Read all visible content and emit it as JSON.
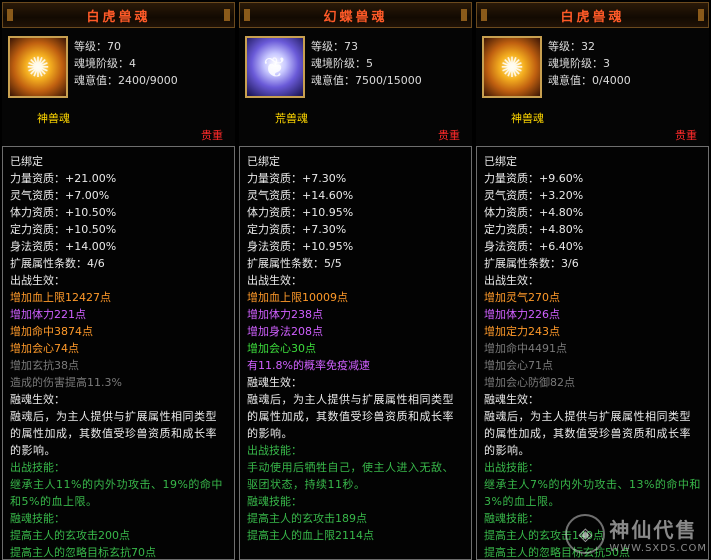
{
  "panels": [
    {
      "title": "白虎兽魂",
      "icon": "tiger-icon",
      "level": "等级：70",
      "stage": "魂境阶级：4",
      "exp": "魂意值：2400/9000",
      "type_label": "神兽魂",
      "rarity": "贵重",
      "bound": "已绑定",
      "attrs": [
        "力量资质：+21.00%",
        "灵气资质：+7.00%",
        "体力资质：+10.50%",
        "定力资质：+10.50%",
        "身法资质：+14.00%"
      ],
      "ext_count": "扩展属性条数：4/6",
      "battle_title": "出战生效：",
      "battle_effects": [
        {
          "text": "增加血上限12427点",
          "color": "orange"
        },
        {
          "text": "增加体力221点",
          "color": "purple"
        },
        {
          "text": "增加命中3874点",
          "color": "orange"
        },
        {
          "text": "增加会心74点",
          "color": "orange"
        },
        {
          "text": "增加玄抗38点",
          "color": "gray"
        },
        {
          "text": "造成的伤害提高11.3%",
          "color": "gray"
        }
      ],
      "fusion_title": "融魂生效：",
      "fusion_desc": "融魂后，为主人提供与扩展属性相同类型的属性加成，其数值受珍兽资质和成长率的影响。",
      "skill_title": "出战技能：",
      "skill_desc": "继承主人11%的内外功攻击、19%的命中和5%的血上限。",
      "fskill_title": "融魂技能：",
      "fskill_lines": [
        "提高主人的玄攻击200点",
        "提高主人的忽略目标玄抗70点"
      ]
    },
    {
      "title": "幻蝶兽魂",
      "icon": "butterfly-icon",
      "level": "等级：73",
      "stage": "魂境阶级：5",
      "exp": "魂意值：7500/15000",
      "type_label": "荒兽魂",
      "rarity": "贵重",
      "bound": "已绑定",
      "attrs": [
        "力量资质：+7.30%",
        "灵气资质：+14.60%",
        "体力资质：+10.95%",
        "定力资质：+7.30%",
        "身法资质：+10.95%"
      ],
      "ext_count": "扩展属性条数：5/5",
      "battle_title": "出战生效：",
      "battle_effects": [
        {
          "text": "增加血上限10009点",
          "color": "orange"
        },
        {
          "text": "增加体力238点",
          "color": "purple"
        },
        {
          "text": "增加身法208点",
          "color": "purple"
        },
        {
          "text": "增加会心30点",
          "color": "green"
        },
        {
          "text": "有11.8%的概率免疫减速",
          "color": "purple"
        }
      ],
      "fusion_title": "融魂生效：",
      "fusion_desc": "融魂后，为主人提供与扩展属性相同类型的属性加成，其数值受珍兽资质和成长率的影响。",
      "skill_title": "出战技能：",
      "skill_desc": "手动使用后牺牲自己，使主人进入无敌、驱团状态，持续11秒。",
      "fskill_title": "融魂技能：",
      "fskill_lines": [
        "提高主人的玄攻击189点",
        "提高主人的血上限2114点"
      ]
    },
    {
      "title": "白虎兽魂",
      "icon": "tiger-icon",
      "level": "等级：32",
      "stage": "魂境阶级：3",
      "exp": "魂意值：0/4000",
      "type_label": "神兽魂",
      "rarity": "贵重",
      "bound": "已绑定",
      "attrs": [
        "力量资质：+9.60%",
        "灵气资质：+3.20%",
        "体力资质：+4.80%",
        "定力资质：+4.80%",
        "身法资质：+6.40%"
      ],
      "ext_count": "扩展属性条数：3/6",
      "battle_title": "出战生效：",
      "battle_effects": [
        {
          "text": "增加灵气270点",
          "color": "orange"
        },
        {
          "text": "增加体力226点",
          "color": "purple"
        },
        {
          "text": "增加定力243点",
          "color": "orange"
        },
        {
          "text": "增加命中4491点",
          "color": "gray"
        },
        {
          "text": "增加会心71点",
          "color": "gray"
        },
        {
          "text": "增加会心防御82点",
          "color": "gray"
        }
      ],
      "fusion_title": "融魂生效：",
      "fusion_desc": "融魂后，为主人提供与扩展属性相同类型的属性加成，其数值受珍兽资质和成长率的影响。",
      "skill_title": "出战技能：",
      "skill_desc": "继承主人7%的内外功攻击、13%的命中和3%的血上限。",
      "fskill_title": "融魂技能：",
      "fskill_lines": [
        "提高主人的玄攻击140点",
        "提高主人的忽略目标玄抗50点"
      ]
    }
  ],
  "watermark": {
    "title": "神仙代售",
    "url": "WWW.SXDS.COM",
    "logo": "shield-logo"
  }
}
